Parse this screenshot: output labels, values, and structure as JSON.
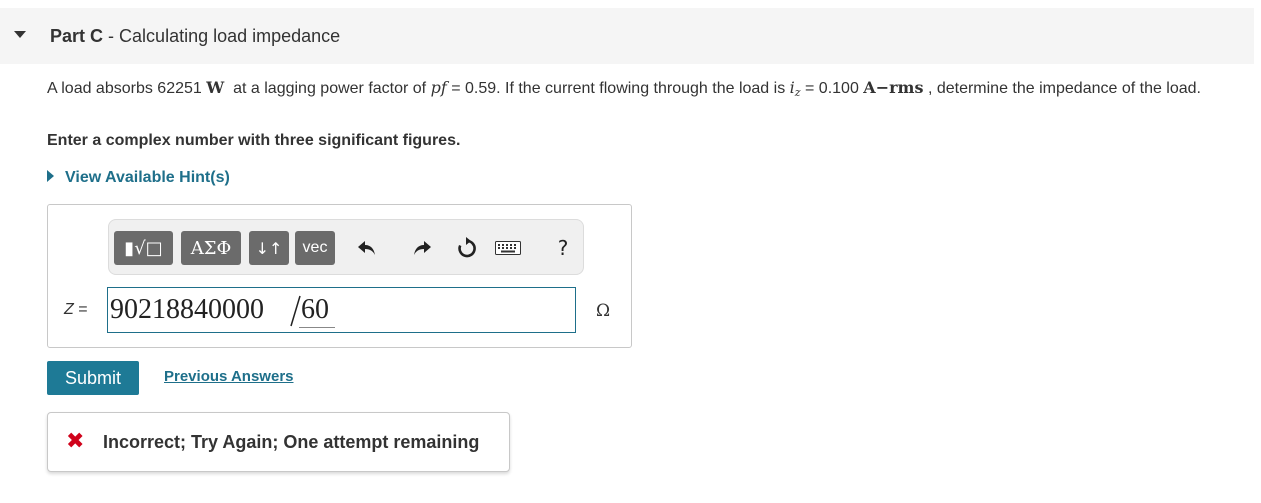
{
  "part": {
    "label": "Part C",
    "separator": "-",
    "title": "Calculating load impedance"
  },
  "question": {
    "text1": "A load absorbs 62251",
    "power_unit": "W",
    "text2": "at a lagging power factor of",
    "pf_symbol": "pf",
    "text3": "= 0.59. If the current flowing through the load is",
    "current_symbol": "i",
    "current_subscript": "z",
    "text4": "= 0.100",
    "current_unit": "A−rms",
    "text5": ", determine the impedance of the load."
  },
  "instruction": "Enter a complex number with three significant figures.",
  "hints_label": "View Available Hint(s)",
  "toolbar": {
    "templates_label": "▮√□",
    "greek_label": "ΑΣΦ",
    "arrows_label": "↓↑",
    "vec_label": "vec",
    "undo_icon": "undo-icon",
    "redo_icon": "redo-icon",
    "reset_icon": "reset-icon",
    "keyboard_icon": "keyboard-icon",
    "help_label": "?"
  },
  "answer": {
    "variable": "Z",
    "equals": "=",
    "numerator": "90218840000",
    "denominator": "60",
    "unit": "Ω"
  },
  "actions": {
    "submit_label": "Submit",
    "previous_answers_label": "Previous Answers"
  },
  "feedback": {
    "icon": "✖",
    "message": "Incorrect; Try Again; One attempt remaining"
  },
  "colors": {
    "accent": "#1e7a96",
    "link": "#1e6f8a",
    "error": "#d0021b",
    "header_bg": "#f5f5f5",
    "toolbar_button": "#6b6b6b"
  }
}
